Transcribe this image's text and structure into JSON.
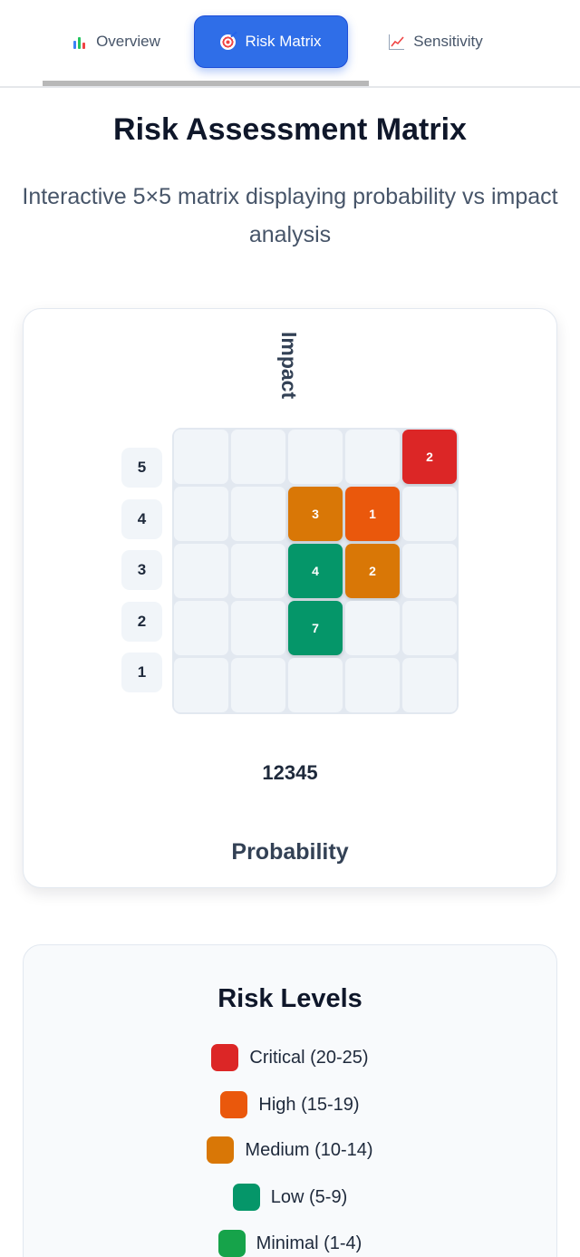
{
  "tabs": [
    {
      "label": "Overview",
      "icon": "bar-chart-icon",
      "active": false
    },
    {
      "label": "Risk Matrix",
      "icon": "target-icon",
      "active": true
    },
    {
      "label": "Sensitivity",
      "icon": "line-chart-icon",
      "active": false
    }
  ],
  "header": {
    "title": "Risk Assessment Matrix",
    "subtitle": "Interactive 5×5 matrix displaying probability vs impact analysis"
  },
  "matrix": {
    "impact_label": "Impact",
    "probability_label": "Probability",
    "impact_levels": [
      "5",
      "4",
      "3",
      "2",
      "1"
    ],
    "probability_levels_text": "12345",
    "rows": [
      [
        "",
        "",
        "",
        "",
        "2"
      ],
      [
        "",
        "",
        "3",
        "1",
        ""
      ],
      [
        "",
        "",
        "4",
        "2",
        ""
      ],
      [
        "",
        "",
        "7",
        "",
        ""
      ],
      [
        "",
        "",
        "",
        "",
        ""
      ]
    ],
    "row_colors": [
      [
        "",
        "",
        "",
        "",
        "#dc2626"
      ],
      [
        "",
        "",
        "#d97706",
        "#ea580c",
        ""
      ],
      [
        "",
        "",
        "#059669",
        "#d97706",
        ""
      ],
      [
        "",
        "",
        "#059669",
        "",
        ""
      ],
      [
        "",
        "",
        "",
        "",
        ""
      ]
    ]
  },
  "legend": {
    "title": "Risk Levels",
    "items": [
      {
        "label": "Critical (20-25)",
        "color": "#dc2626"
      },
      {
        "label": "High (15-19)",
        "color": "#ea580c"
      },
      {
        "label": "Medium (10-14)",
        "color": "#d97706"
      },
      {
        "label": "Low (5-9)",
        "color": "#059669"
      },
      {
        "label": "Minimal (1-4)",
        "color": "#16a34a"
      }
    ]
  }
}
